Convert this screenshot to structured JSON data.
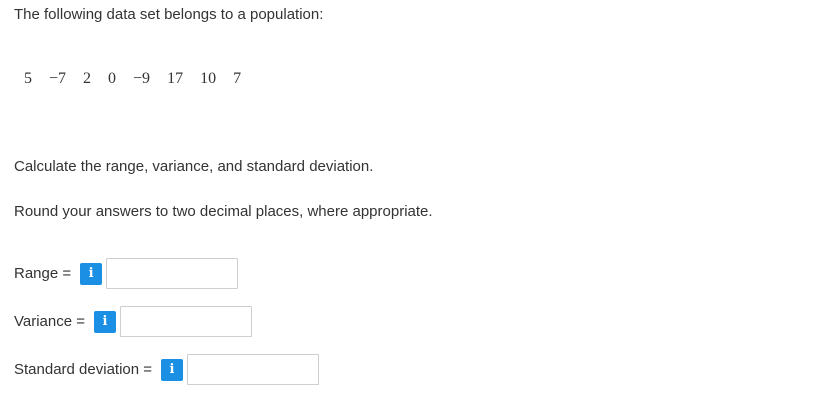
{
  "problem": {
    "intro": "The following data set belongs to a population:",
    "dataset": [
      "5",
      "−7",
      "2",
      "0",
      "−9",
      "17",
      "10",
      "7"
    ],
    "instruction_1": "Calculate the range, variance, and standard deviation.",
    "instruction_2": "Round your answers to two decimal places, where appropriate."
  },
  "answers": {
    "range": {
      "label": "Range =",
      "value": ""
    },
    "variance": {
      "label": "Variance =",
      "value": ""
    },
    "standard_deviation": {
      "label": "Standard deviation =",
      "value": ""
    }
  },
  "info_icon": {
    "glyph": "i",
    "icon": "info-icon",
    "color": "#1a8fe3"
  }
}
